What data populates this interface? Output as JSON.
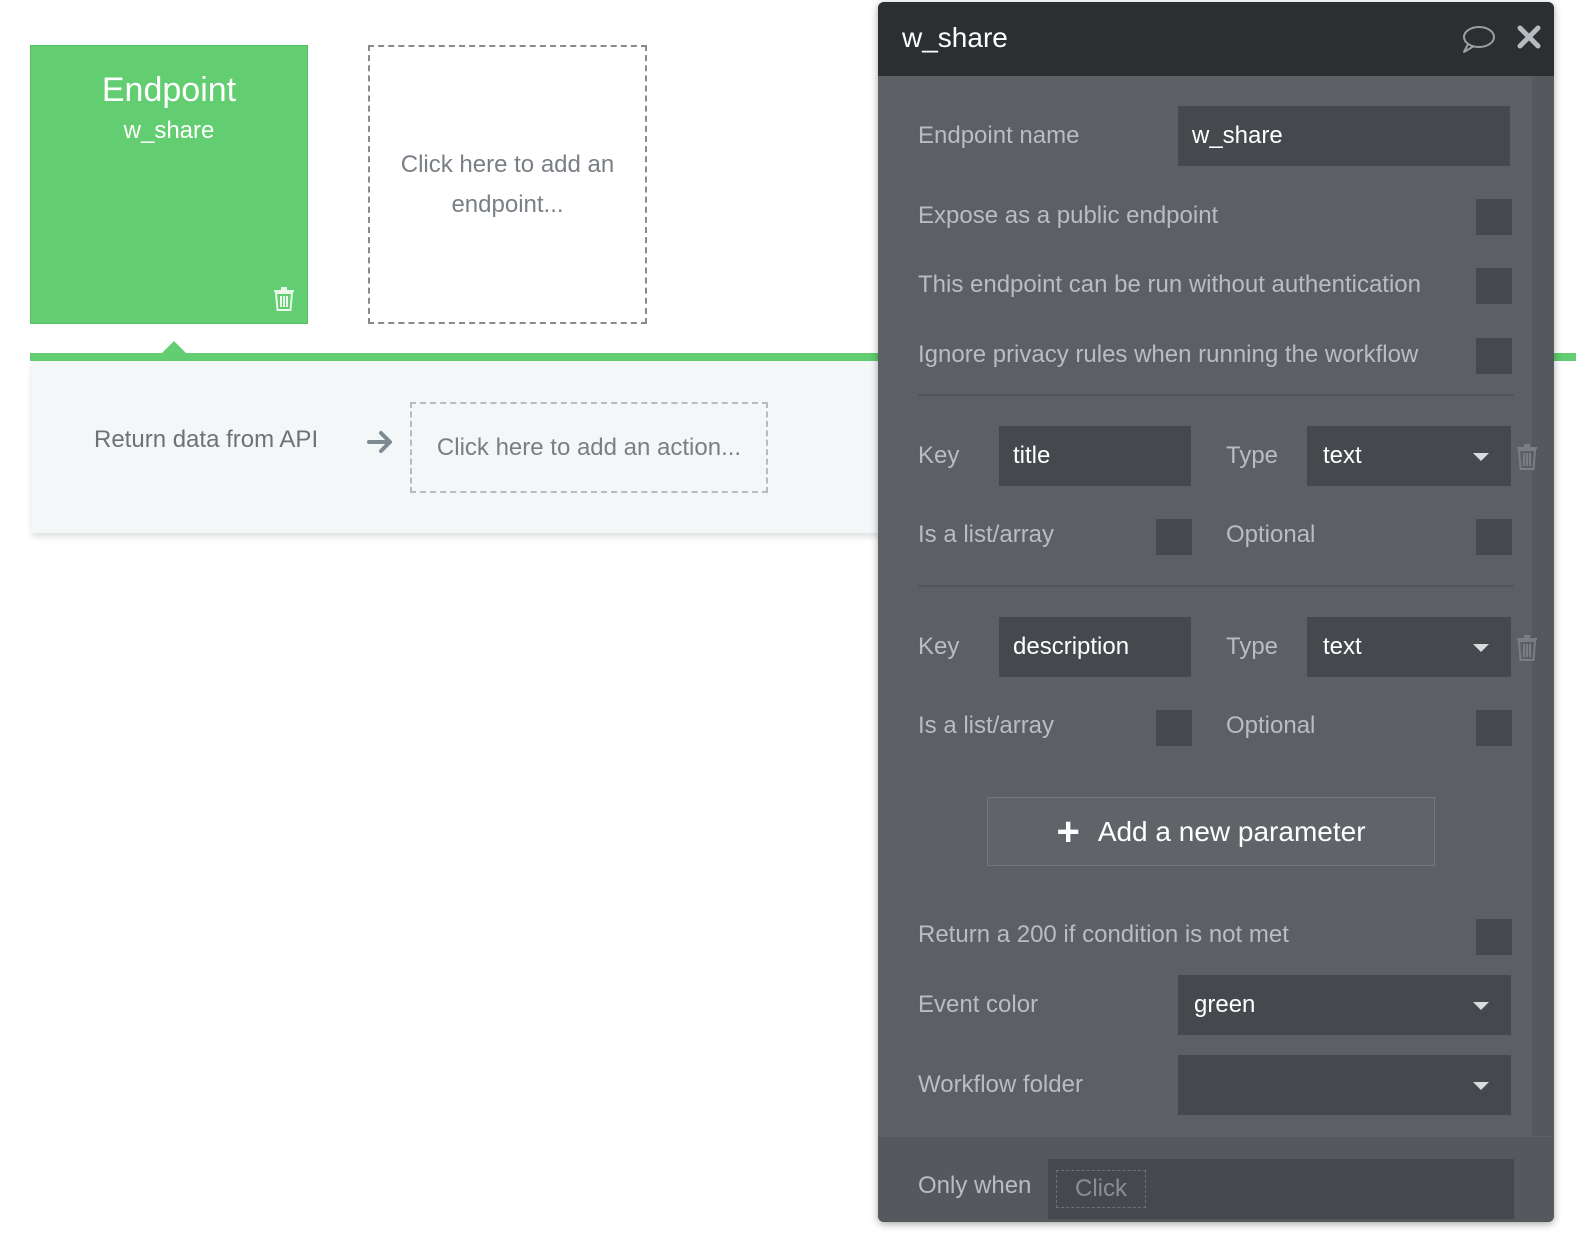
{
  "canvas": {
    "endpoint_card": {
      "title": "Endpoint",
      "name": "w_share"
    },
    "add_endpoint_label": "Click here to add an endpoint...",
    "workflow": {
      "step_label": "Return data from API",
      "add_action_label": "Click here to add an action..."
    }
  },
  "panel": {
    "title": "w_share",
    "endpoint_name_label": "Endpoint name",
    "endpoint_name_value": "w_share",
    "expose_public_label": "Expose as a public endpoint",
    "no_auth_label": "This endpoint can be run without authentication",
    "ignore_privacy_label": "Ignore privacy rules when running the workflow",
    "parameters": [
      {
        "key_label": "Key",
        "key_value": "title",
        "type_label": "Type",
        "type_value": "text",
        "list_label": "Is a list/array",
        "optional_label": "Optional"
      },
      {
        "key_label": "Key",
        "key_value": "description",
        "type_label": "Type",
        "type_value": "text",
        "list_label": "Is a list/array",
        "optional_label": "Optional"
      }
    ],
    "add_parameter_label": "Add a new parameter",
    "return_200_label": "Return a 200 if condition is not met",
    "event_color_label": "Event color",
    "event_color_value": "green",
    "workflow_folder_label": "Workflow folder",
    "workflow_folder_value": "",
    "only_when_label": "Only when",
    "only_when_placeholder": "Click"
  },
  "colors": {
    "endpoint_green": "#62cd71",
    "panel_bg": "#5c5f63",
    "header_bg": "#2b2f31"
  },
  "icons": [
    "trash-icon",
    "arrow-right-icon",
    "comment-icon",
    "close-icon",
    "plus-icon",
    "chevron-down-icon"
  ]
}
